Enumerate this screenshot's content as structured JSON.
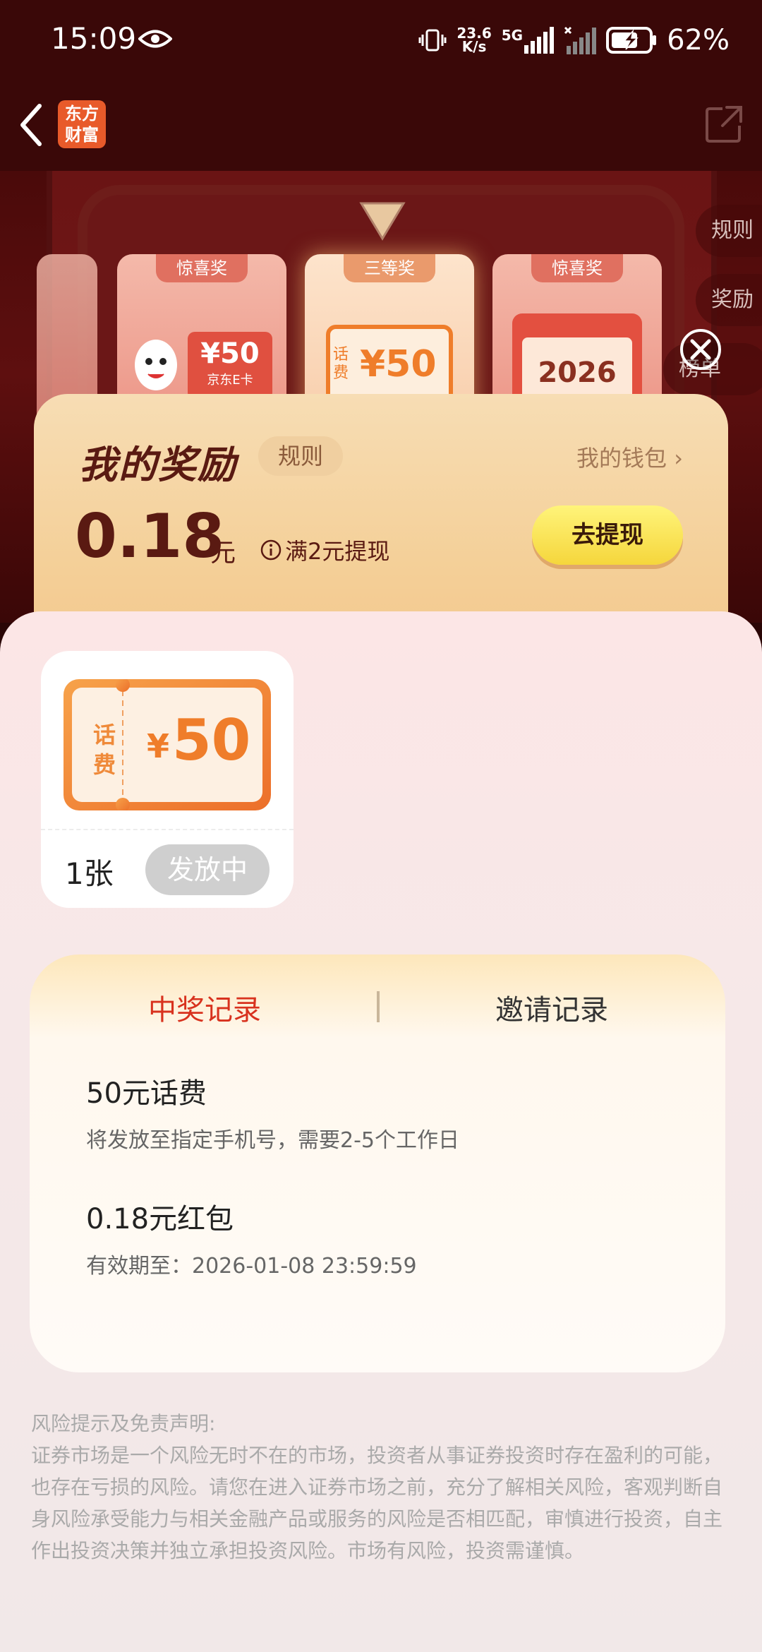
{
  "status_bar": {
    "time": "15:09",
    "net_speed_value": "23.6",
    "net_speed_unit": "K/s",
    "network": "5G",
    "battery_percent": "62%",
    "icons": [
      "eye-icon",
      "vibrate-icon",
      "signal-icon",
      "signal-no-service-icon",
      "battery-charging-icon"
    ]
  },
  "nav": {
    "logo_line1": "东方",
    "logo_line2": "财富",
    "icons": [
      "back-arrow-icon",
      "share-icon"
    ]
  },
  "game": {
    "prizes": [
      {
        "tag": "惊喜奖",
        "face_value": "¥50",
        "desc": "京东E卡"
      },
      {
        "tag": "三等奖",
        "coupon_label": "话费",
        "face_value": "¥50"
      },
      {
        "tag": "惊喜奖",
        "face_value": "2026"
      }
    ],
    "side_buttons": [
      "规则",
      "奖励",
      "榜单"
    ]
  },
  "reward": {
    "title": "我的奖励",
    "rules": "规则",
    "wallet": "我的钱包 ›",
    "amount": "0.18",
    "unit": "元",
    "min_withdraw": "满2元提现",
    "withdraw_button": "去提现"
  },
  "coupon": {
    "label_line1": "话",
    "label_line2": "费",
    "currency": "¥",
    "value": "50",
    "count": "1张",
    "status": "发放中"
  },
  "records": {
    "tabs": [
      "中奖记录",
      "邀请记录"
    ],
    "active_tab": 0,
    "items": [
      {
        "title": "50元话费",
        "subtitle": "将发放至指定手机号，需要2-5个工作日"
      },
      {
        "title": "0.18元红包",
        "subtitle": "有效期至：2026-01-08 23:59:59"
      }
    ]
  },
  "disclaimer": {
    "heading": "风险提示及免责声明:",
    "body": "证券市场是一个风险无时不在的市场，投资者从事证券投资时存在盈利的可能，也存在亏损的风险。请您在进入证券市场之前，充分了解相关风险，客观判断自身风险承受能力与相关金融产品或服务的风险是否相匹配，审慎进行投资，自主作出投资决策并独立承担投资风险。市场有风险，投资需谨慎。"
  },
  "colors": {
    "header_bg": "#3a0808",
    "accent_red": "#d8321e",
    "title_brown": "#5a1a12",
    "withdraw_yellow": "#f5d63c",
    "coupon_orange": "#ef7d2a"
  }
}
